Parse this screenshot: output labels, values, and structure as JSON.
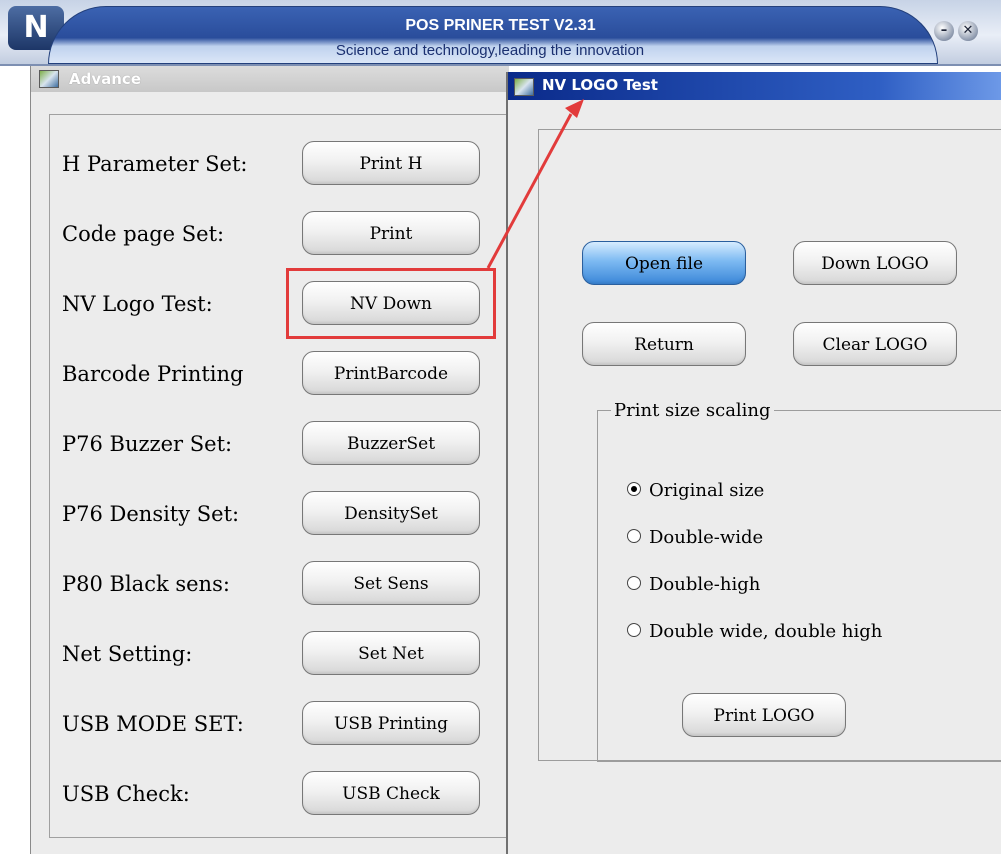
{
  "window": {
    "title": "POS PRINER TEST V2.31",
    "subtitle": "Science and technology,leading the innovation",
    "minimize_glyph": "–",
    "close_glyph": "✕",
    "logo_glyph": "N"
  },
  "advance": {
    "title": "Advance",
    "rows": [
      {
        "label": "H Parameter Set:",
        "button": "Print H"
      },
      {
        "label": "Code page Set:",
        "button": "Print"
      },
      {
        "label": "NV Logo Test:",
        "button": "NV Down"
      },
      {
        "label": "Barcode Printing",
        "button": "PrintBarcode"
      },
      {
        "label": "P76 Buzzer Set:",
        "button": "BuzzerSet"
      },
      {
        "label": "P76 Density Set:",
        "button": "DensitySet"
      },
      {
        "label": "P80 Black sens:",
        "button": "Set Sens"
      },
      {
        "label": "Net Setting:",
        "button": "Set Net"
      },
      {
        "label": "USB MODE SET:",
        "button": "USB Printing"
      },
      {
        "label": "USB Check:",
        "button": "USB Check"
      }
    ]
  },
  "nv_logo": {
    "title": "NV LOGO Test",
    "buttons": {
      "open_file": "Open file",
      "down_logo": "Down LOGO",
      "return": "Return",
      "clear_logo": "Clear LOGO",
      "print_logo": "Print LOGO"
    },
    "scaling": {
      "legend": "Print size scaling",
      "options": [
        {
          "label": "Original size",
          "selected": true
        },
        {
          "label": "Double-wide",
          "selected": false
        },
        {
          "label": "Double-high",
          "selected": false
        },
        {
          "label": "Double wide, double high",
          "selected": false
        }
      ]
    }
  },
  "annotation": {
    "color": "#e23b3b"
  }
}
